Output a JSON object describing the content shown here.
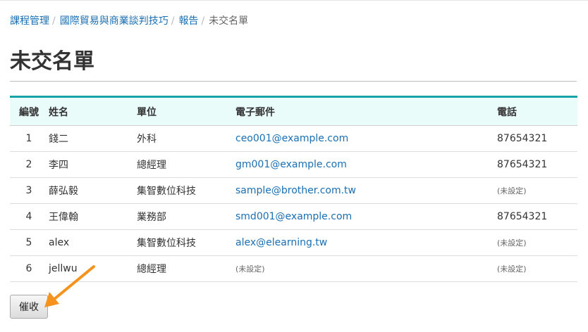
{
  "breadcrumb": {
    "items": [
      "課程管理",
      "國際貿易與商業談判技巧",
      "報告"
    ],
    "current": "未交名單",
    "separator": "/"
  },
  "page": {
    "title": "未交名單"
  },
  "table": {
    "headers": [
      "編號",
      "姓名",
      "單位",
      "電子郵件",
      "電話"
    ],
    "rows": [
      {
        "no": "1",
        "name": "錢二",
        "unit": "外科",
        "email": "ceo001@example.com",
        "phone": "87654321"
      },
      {
        "no": "2",
        "name": "李四",
        "unit": "總經理",
        "email": "gm001@example.com",
        "phone": "87654321"
      },
      {
        "no": "3",
        "name": "薛弘毅",
        "unit": "集智數位科技",
        "email": "sample@brother.com.tw",
        "phone": "(未設定)"
      },
      {
        "no": "4",
        "name": "王偉翰",
        "unit": "業務部",
        "email": "smd001@example.com",
        "phone": "87654321"
      },
      {
        "no": "5",
        "name": "alex",
        "unit": "集智數位科技",
        "email": "alex@elearning.tw",
        "phone": "(未設定)"
      },
      {
        "no": "6",
        "name": "jellwu",
        "unit": "總經理",
        "email": "(未設定)",
        "phone": "(未設定)"
      }
    ]
  },
  "actions": {
    "urge_label": "催收"
  },
  "colors": {
    "link": "#1a6fb3",
    "header_accent": "#17a2a8",
    "header_bg": "#eafcfa",
    "arrow": "#f5931e"
  },
  "icons": {
    "annotation": "arrow-icon"
  }
}
